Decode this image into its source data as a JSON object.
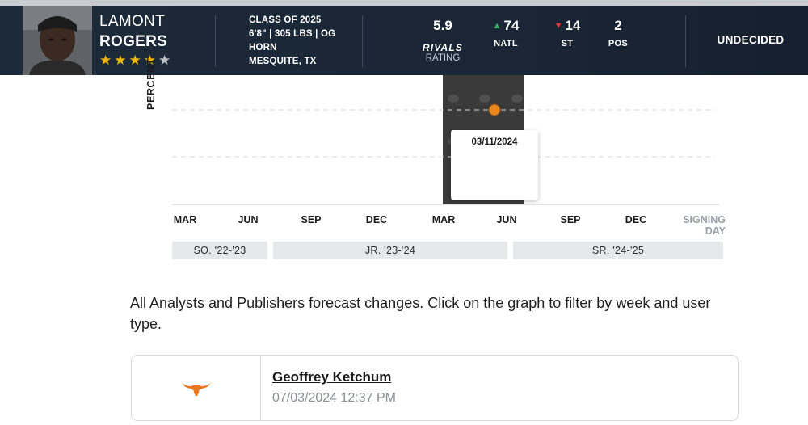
{
  "player": {
    "first_name": "LAMONT",
    "last_name": "ROGERS",
    "stars": 4,
    "max_stars": 5,
    "star_color": "#f2b705",
    "class": "CLASS OF 2025",
    "size": "6'8\" | 305 LBS | OG",
    "school": "HORN",
    "hometown": "MESQUITE, TX",
    "rating": "5.9",
    "rating_brand": "RIVALS",
    "rating_label": "RATING",
    "status": "UNDECIDED"
  },
  "ranks": [
    {
      "value": "74",
      "label": "NATL",
      "trend": "up",
      "trend_icon": "arrow-up-icon",
      "trend_color": "#2fbf55"
    },
    {
      "value": "14",
      "label": "ST",
      "trend": "down",
      "trend_icon": "arrow-down-icon",
      "trend_color": "#e23b3b"
    },
    {
      "value": "2",
      "label": "POS",
      "trend": "none"
    }
  ],
  "chart": {
    "y_axis_label": "PERCENT",
    "months": [
      "MAR",
      "JUN",
      "SEP",
      "DEC",
      "MAR",
      "JUN",
      "SEP",
      "DEC"
    ],
    "end_label_line1": "SIGNING",
    "end_label_line2": "DAY",
    "seasons": [
      "SO. '22-'23",
      "JR. '23-'24",
      "SR. '24-'25"
    ],
    "tooltip_date": "03/11/2024",
    "highlight_color": "#3a3a3a",
    "point_color": "#e8871e"
  },
  "chart_data": {
    "type": "scatter",
    "title": "",
    "ylabel": "PERCENT",
    "xlabel": "",
    "x_ticks": [
      "MAR",
      "JUN",
      "SEP",
      "DEC",
      "MAR",
      "JUN",
      "SEP",
      "DEC",
      "SIGNING DAY"
    ],
    "x_groups": [
      "SO. '22-'23",
      "JR. '23-'24",
      "SR. '24-'25"
    ],
    "highlighted_week": "03/11/2024",
    "series": [
      {
        "points": [
          {
            "x": "03/11/2024"
          }
        ],
        "color": "#e8871e"
      }
    ],
    "grid": true
  },
  "description": "All Analysts and Publishers forecast changes. Click on the graph to filter by week and user type.",
  "forecast": {
    "logo_icon": "longhorn-logo-icon",
    "logo_color": "#e8771e",
    "analyst": "Geoffrey Ketchum",
    "timestamp": "07/03/2024 12:37 PM"
  }
}
